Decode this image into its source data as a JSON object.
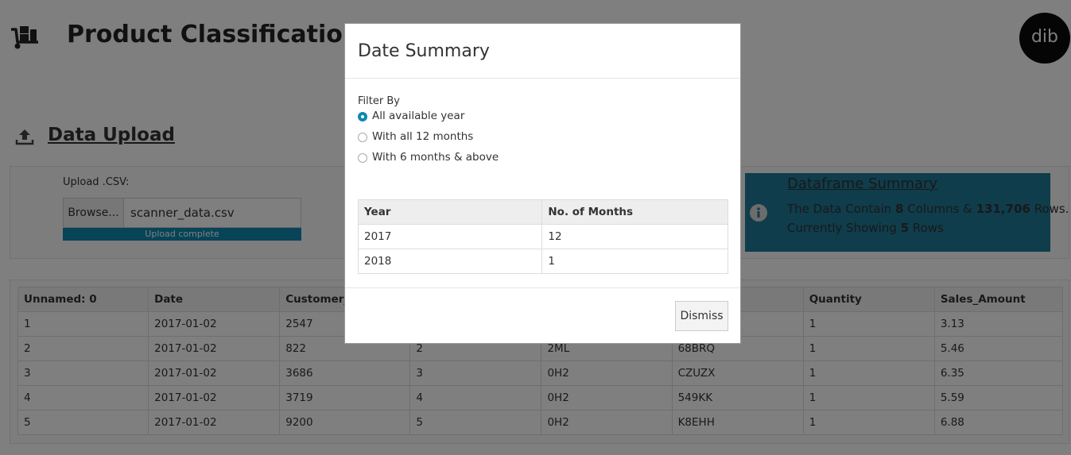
{
  "header": {
    "title": "Product Classification",
    "avatar_text": "dib",
    "logo_icon": "dolly-icon"
  },
  "upload": {
    "section_title": "Data Upload",
    "icon": "upload-icon",
    "label": "Upload .CSV:",
    "browse_label": "Browse...",
    "file_name": "scanner_data.csv",
    "status": "Upload complete",
    "progress": 1.0,
    "progress_color": "#0e88b0"
  },
  "summary": {
    "title": "Dataframe Summary",
    "line1_a": "The Data Contain ",
    "columns": "8",
    "line1_b": " Columns & ",
    "rows": "131,706",
    "line1_c": " Rows.",
    "line2_a": "Currently Showing ",
    "showing": "5",
    "line2_b": " Rows",
    "background": "#1f7a99"
  },
  "table": {
    "columns": [
      "Unnamed: 0",
      "Date",
      "Customer_I",
      "",
      "",
      "",
      "Quantity",
      "Sales_Amount"
    ],
    "rows": [
      [
        "1",
        "2017-01-02",
        "2547",
        "",
        "",
        "",
        "1",
        "3.13"
      ],
      [
        "2",
        "2017-01-02",
        "822",
        "2",
        "2ML",
        "68BRQ",
        "1",
        "5.46"
      ],
      [
        "3",
        "2017-01-02",
        "3686",
        "3",
        "0H2",
        "CZUZX",
        "1",
        "6.35"
      ],
      [
        "4",
        "2017-01-02",
        "3719",
        "4",
        "0H2",
        "549KK",
        "1",
        "5.59"
      ],
      [
        "5",
        "2017-01-02",
        "9200",
        "5",
        "0H2",
        "K8EHH",
        "1",
        "6.88"
      ]
    ]
  },
  "modal": {
    "title": "Date Summary",
    "filter_label": "Filter By",
    "options": [
      {
        "label": "All available year",
        "checked": true
      },
      {
        "label": "With all 12 months",
        "checked": false
      },
      {
        "label": "With 6 months & above",
        "checked": false
      }
    ],
    "table_headers": [
      "Year",
      "No. of Months"
    ],
    "table_rows": [
      [
        "2017",
        "12"
      ],
      [
        "2018",
        "1"
      ]
    ],
    "dismiss_label": "Dismiss"
  }
}
